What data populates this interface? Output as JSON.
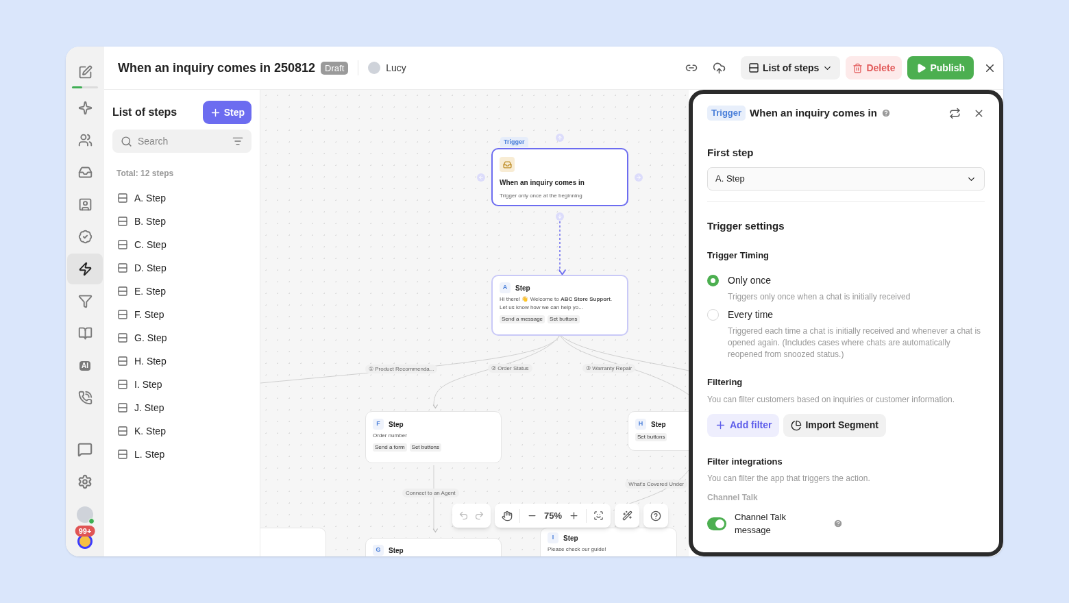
{
  "rail": {
    "progress": {
      "level": 0.4
    },
    "items": [
      {
        "selected": false
      },
      {
        "selected": false
      },
      {
        "selected": false
      },
      {
        "selected": false
      },
      {
        "selected": false
      },
      {
        "selected": false
      },
      {
        "selected": true
      },
      {
        "selected": false
      },
      {
        "selected": false
      },
      {
        "selected": false,
        "label": "AI"
      },
      {
        "selected": false
      }
    ],
    "bottom_badge": "99+"
  },
  "header": {
    "title": "When an inquiry comes in 250812",
    "status": "Draft",
    "user": "Lucy",
    "buttons": [
      {
        "kind": "list",
        "label": "List of steps"
      },
      {
        "kind": "delete",
        "label": "Delete"
      },
      {
        "kind": "publish",
        "label": "Publish"
      }
    ]
  },
  "steps_panel": {
    "title": "List of steps",
    "add_button": "Step",
    "search": {
      "placeholder": "Search"
    },
    "total": "Total: 12 steps",
    "items": [
      "A. Step",
      "B. Step",
      "C. Step",
      "D. Step",
      "E. Step",
      "F. Step",
      "G. Step",
      "H. Step",
      "I. Step",
      "J. Step",
      "K. Step",
      "L. Step"
    ]
  },
  "canvas": {
    "trigger": {
      "tag": "Trigger",
      "title": "When an inquiry comes in",
      "subtitle": "Trigger only once at the beginning",
      "selected": true
    },
    "nodes": [
      {
        "letter": "A",
        "title": "Step",
        "body": "Hi there! 👋 Welcome to **ABC Store Support**. Let us know how we can help yo...",
        "chips": [
          "Send a message",
          "Set buttons"
        ]
      },
      {
        "letter": "F",
        "title": "Step",
        "body": "Order number",
        "chips": [
          "Send a form",
          "Set buttons"
        ]
      },
      {
        "letter": "H",
        "title": "Step",
        "chips": [
          "Set buttons"
        ]
      },
      {
        "letter": "G",
        "title": "Step"
      },
      {
        "letter": "I",
        "title": "Step",
        "body": "Please check our guide!"
      }
    ],
    "edge_labels": [
      "① Product Recommenda...",
      "② Order Status",
      "③ Warranty Repair",
      "Connect to an Agent",
      "What's Covered Under"
    ],
    "zoom": "75%"
  },
  "detail_panel": {
    "tag": "Trigger",
    "title": "When an inquiry comes in",
    "first_step": {
      "label": "First step",
      "value": "A. Step"
    },
    "section": "Trigger settings",
    "timing": {
      "label": "Trigger Timing",
      "options": [
        {
          "label": "Only once",
          "description": "Triggers only once when a chat is initially received",
          "selected": true
        },
        {
          "label": "Every time",
          "description": "Triggered each time a chat is initially received and whenever a chat is opened again. (Includes cases where chats are automatically reopened from snoozed status.)",
          "selected": false
        }
      ]
    },
    "filtering": {
      "label": "Filtering",
      "description": "You can filter customers based on inquiries or customer information.",
      "buttons": [
        {
          "kind": "add",
          "label": "Add filter"
        },
        {
          "kind": "segment",
          "label": "Import Segment"
        }
      ]
    },
    "integrations": {
      "label": "Filter integrations",
      "description": "You can filter the app that triggers the action.",
      "group": "Channel Talk",
      "toggle": {
        "label": "Channel Talk message",
        "on": true
      }
    }
  }
}
